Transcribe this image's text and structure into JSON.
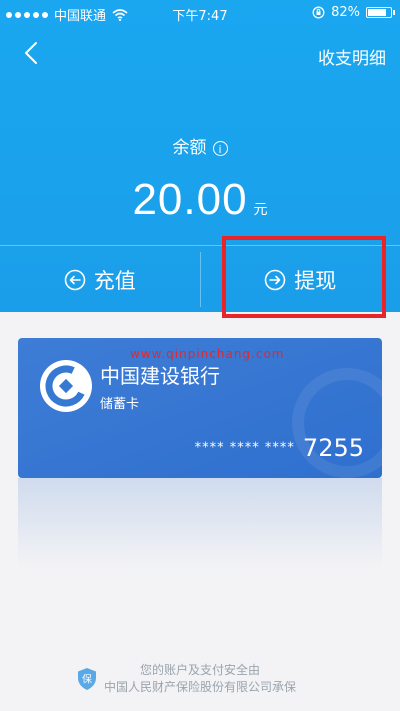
{
  "status_bar": {
    "carrier": "中国联通",
    "time": "下午7:47",
    "battery": "82%",
    "battery_level": 0.82
  },
  "nav": {
    "back_icon": "chevron-left-icon",
    "detail_label": "收支明细"
  },
  "balance": {
    "label": "余额",
    "info_icon": "info-icon",
    "info_glyph": "i",
    "amount": "20.00",
    "unit": "元"
  },
  "actions": [
    {
      "label": "充值",
      "icon": "arrow-left-circle-icon"
    },
    {
      "label": "提现",
      "icon": "arrow-right-circle-icon"
    }
  ],
  "card": {
    "bank_name": "中国建设银行",
    "card_type": "储蓄卡",
    "masked": "**** **** ****",
    "last_digits": "7255"
  },
  "watermark_text": "www.qinpinchang.com",
  "footer": {
    "line1": "您的账户及支付安全由",
    "line2": "中国人民财产保险股份有限公司承保",
    "shield_glyph": "保"
  },
  "colors": {
    "header_blue": "#1aa7f0",
    "card_blue": "#3579d2",
    "highlight_red": "#e8262a"
  }
}
